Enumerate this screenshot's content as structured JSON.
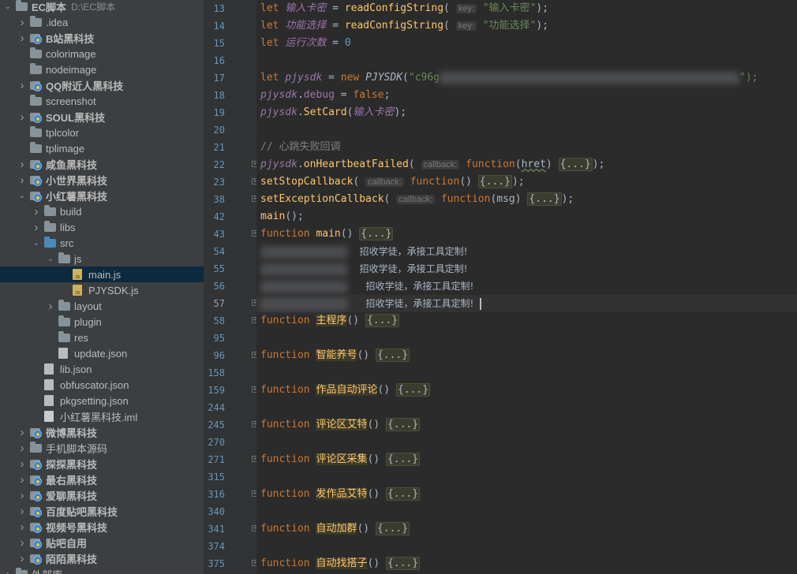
{
  "sidebar": {
    "root": {
      "name": "EC脚本",
      "path": "D:\\EC脚本"
    },
    "items": [
      {
        "label": "EC脚本",
        "depth": 0,
        "type": "folder",
        "expanded": true,
        "bold": true
      },
      {
        "label": ".idea",
        "depth": 1,
        "type": "folder",
        "expanded": false
      },
      {
        "label": "B站黑科技",
        "depth": 1,
        "type": "module",
        "expanded": false,
        "bold": true
      },
      {
        "label": "colorimage",
        "depth": 1,
        "type": "folder",
        "expanded": null
      },
      {
        "label": "nodeimage",
        "depth": 1,
        "type": "folder",
        "expanded": null
      },
      {
        "label": "QQ附近人黑科技",
        "depth": 1,
        "type": "module",
        "expanded": false,
        "bold": true
      },
      {
        "label": "screenshot",
        "depth": 1,
        "type": "folder",
        "expanded": null
      },
      {
        "label": "SOUL黑科技",
        "depth": 1,
        "type": "module",
        "expanded": false,
        "bold": true
      },
      {
        "label": "tplcolor",
        "depth": 1,
        "type": "folder",
        "expanded": null
      },
      {
        "label": "tplimage",
        "depth": 1,
        "type": "folder",
        "expanded": null
      },
      {
        "label": "咸鱼黑科技",
        "depth": 1,
        "type": "module",
        "expanded": false,
        "bold": true
      },
      {
        "label": "小世界黑科技",
        "depth": 1,
        "type": "module",
        "expanded": false,
        "bold": true
      },
      {
        "label": "小红薯黑科技",
        "depth": 1,
        "type": "module",
        "expanded": true,
        "bold": true
      },
      {
        "label": "build",
        "depth": 2,
        "type": "folder",
        "expanded": false
      },
      {
        "label": "libs",
        "depth": 2,
        "type": "folder",
        "expanded": false
      },
      {
        "label": "src",
        "depth": 2,
        "type": "folder-blue",
        "expanded": true
      },
      {
        "label": "js",
        "depth": 3,
        "type": "folder",
        "expanded": true
      },
      {
        "label": "main.js",
        "depth": 4,
        "type": "js",
        "expanded": null,
        "selected": true
      },
      {
        "label": "PJYSDK.js",
        "depth": 4,
        "type": "js",
        "expanded": null
      },
      {
        "label": "layout",
        "depth": 3,
        "type": "folder",
        "expanded": false
      },
      {
        "label": "plugin",
        "depth": 3,
        "type": "folder",
        "expanded": null
      },
      {
        "label": "res",
        "depth": 3,
        "type": "folder",
        "expanded": null
      },
      {
        "label": "update.json",
        "depth": 3,
        "type": "json",
        "expanded": null
      },
      {
        "label": "lib.json",
        "depth": 2,
        "type": "json",
        "expanded": null
      },
      {
        "label": "obfuscator.json",
        "depth": 2,
        "type": "json",
        "expanded": null
      },
      {
        "label": "pkgsetting.json",
        "depth": 2,
        "type": "json",
        "expanded": null
      },
      {
        "label": "小红薯黑科技.iml",
        "depth": 2,
        "type": "iml",
        "expanded": null
      },
      {
        "label": "微博黑科技",
        "depth": 1,
        "type": "module",
        "expanded": false,
        "bold": true
      },
      {
        "label": "手机脚本源码",
        "depth": 1,
        "type": "folder",
        "expanded": false
      },
      {
        "label": "探探黑科技",
        "depth": 1,
        "type": "module",
        "expanded": false,
        "bold": true
      },
      {
        "label": "最右黑科技",
        "depth": 1,
        "type": "module",
        "expanded": false,
        "bold": true
      },
      {
        "label": "爱聊黑科技",
        "depth": 1,
        "type": "module",
        "expanded": false,
        "bold": true
      },
      {
        "label": "百度贴吧黑科技",
        "depth": 1,
        "type": "module",
        "expanded": false,
        "bold": true
      },
      {
        "label": "视频号黑科技",
        "depth": 1,
        "type": "module",
        "expanded": false,
        "bold": true
      },
      {
        "label": "贴吧自用",
        "depth": 1,
        "type": "module",
        "expanded": false,
        "bold": true
      },
      {
        "label": "陌陌黑科技",
        "depth": 1,
        "type": "module",
        "expanded": false,
        "bold": true
      },
      {
        "label": "外部库",
        "depth": 0,
        "type": "lib",
        "expanded": false
      }
    ]
  },
  "editor": {
    "line_numbers": [
      "13",
      "14",
      "15",
      "16",
      "17",
      "18",
      "19",
      "20",
      "21",
      "22",
      "23",
      "38",
      "42",
      "43",
      "54",
      "55",
      "56",
      "57",
      "58",
      "95",
      "96",
      "158",
      "159",
      "244",
      "245",
      "270",
      "271",
      "315",
      "316",
      "340",
      "341",
      "374",
      "375"
    ],
    "current_line": "57",
    "strings": {
      "s1": "\"输入卡密\"",
      "s2": "\"功能选择\"",
      "s3": "\"c96g",
      "v1": "输入卡密",
      "v2": "功能选择",
      "v3": "运行次数",
      "v4": "pjysdk",
      "hint_key": "key:",
      "hint_cb": "callback:",
      "comment": "// 心跳失败回调",
      "recruit": "招收学徒，承接工具定制!",
      "fold": "{...}",
      "fold_close": "{...});",
      "f1": "主程序",
      "f2": "智能养号",
      "f3": "作品自动评论",
      "f4": "评论区艾特",
      "f5": "评论区采集",
      "f6": "发作品艾特",
      "f7": "自动加群",
      "f8": "自动找搭子",
      "trail": "\");"
    }
  },
  "colors": {
    "keyword": "#cc7832",
    "function": "#ffc66d",
    "string": "#6a8759",
    "number": "#6897bb",
    "variable": "#9876aa",
    "comment": "#808080",
    "text": "#a9b7c6"
  }
}
